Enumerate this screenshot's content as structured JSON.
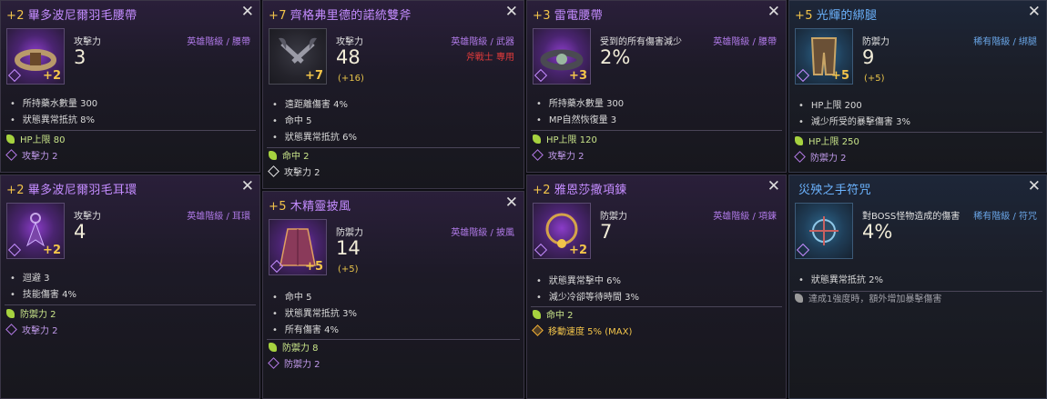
{
  "cards": [
    {
      "enhance": "+2",
      "name": "畢多波尼爾羽毛腰帶",
      "stat_label": "攻擊力",
      "stat_value": "3",
      "grade": "英雄階級 / 腰帶",
      "icon_enhance": "+2",
      "props": [
        "所持藥水數量 300",
        "狀態異常抵抗 8%"
      ],
      "bonus": [
        {
          "icon": "leaf",
          "text": "HP上限 80"
        },
        {
          "icon": "purple-diamond",
          "text": "攻擊力 2"
        }
      ]
    },
    {
      "enhance": "+7",
      "name": "齊格弗里德的諾統雙斧",
      "stat_label": "攻擊力",
      "stat_value": "48",
      "stat_extra": "(+16)",
      "grade": "英雄階級 / 武器",
      "requirement": "斧戰士 專用",
      "icon_enhance": "+7",
      "props": [
        "遠距離傷害 4%",
        "命中 5",
        "狀態異常抵抗 6%"
      ],
      "bonus": [
        {
          "icon": "leaf",
          "text": "命中 2"
        },
        {
          "icon": "white-diamond",
          "text": "攻擊力 2"
        }
      ]
    },
    {
      "enhance": "+3",
      "name": "雷電腰帶",
      "stat_label": "受到的所有傷害減少",
      "stat_value": "2%",
      "grade": "英雄階級 / 腰帶",
      "icon_enhance": "+3",
      "props": [
        "所持藥水數量 300",
        "MP自然恢復量 3"
      ],
      "bonus": [
        {
          "icon": "leaf",
          "text": "HP上限 120"
        },
        {
          "icon": "purple-diamond",
          "text": "攻擊力 2"
        }
      ]
    },
    {
      "enhance": "+5",
      "name": "光輝的綁腿",
      "stat_label": "防禦力",
      "stat_value": "9",
      "stat_extra": "(+5)",
      "grade": "稀有階級 / 綁腿",
      "icon_enhance": "+5",
      "props": [
        "HP上限 200",
        "減少所受的暴擊傷害 3%"
      ],
      "bonus": [
        {
          "icon": "leaf",
          "text": "HP上限 250"
        },
        {
          "icon": "purple-diamond",
          "text": "防禦力 2"
        }
      ]
    },
    {
      "enhance": "+2",
      "name": "畢多波尼爾羽毛耳環",
      "stat_label": "攻擊力",
      "stat_value": "4",
      "grade": "英雄階級 / 耳環",
      "icon_enhance": "+2",
      "props": [
        "迴避 3",
        "技能傷害 4%"
      ],
      "bonus": [
        {
          "icon": "leaf",
          "text": "防禦力 2"
        },
        {
          "icon": "purple-diamond",
          "text": "攻擊力 2"
        }
      ]
    },
    {
      "enhance": "+5",
      "name": "木精靈披風",
      "stat_label": "防禦力",
      "stat_value": "14",
      "stat_extra": "(+5)",
      "grade": "英雄階級 / 披風",
      "icon_enhance": "+5",
      "props": [
        "命中 5",
        "狀態異常抵抗 3%",
        "所有傷害 4%"
      ],
      "bonus": [
        {
          "icon": "leaf",
          "text": "防禦力 8"
        },
        {
          "icon": "purple-diamond",
          "text": "防禦力 2"
        }
      ]
    },
    {
      "enhance": "+2",
      "name": "雅恩莎撒項鍊",
      "stat_label": "防禦力",
      "stat_value": "7",
      "grade": "英雄階級 / 項鍊",
      "icon_enhance": "+2",
      "props": [
        "狀態異常擊中 6%",
        "減少冷卻等待時間 3%"
      ],
      "bonus": [
        {
          "icon": "leaf",
          "text": "命中 2"
        },
        {
          "icon": "orange-diamond",
          "text": "移動速度 5% (MAX)"
        }
      ]
    },
    {
      "enhance": "",
      "name": "災殃之手符咒",
      "stat_label": "對BOSS怪物造成的傷害",
      "stat_value": "4%",
      "grade": "稀有階級 / 符咒",
      "icon_enhance": "",
      "props": [
        "狀態異常抵抗 2%"
      ],
      "bonus": [
        {
          "icon": "grey-leaf",
          "text": "達成1強度時，額外增加暴擊傷害"
        }
      ]
    }
  ],
  "close_glyph": "✕",
  "colors": {
    "enhance": "#f2c44a",
    "hero_name": "#c48cff",
    "rare_name": "#6cb4ff",
    "requirement": "#e23b3b"
  }
}
